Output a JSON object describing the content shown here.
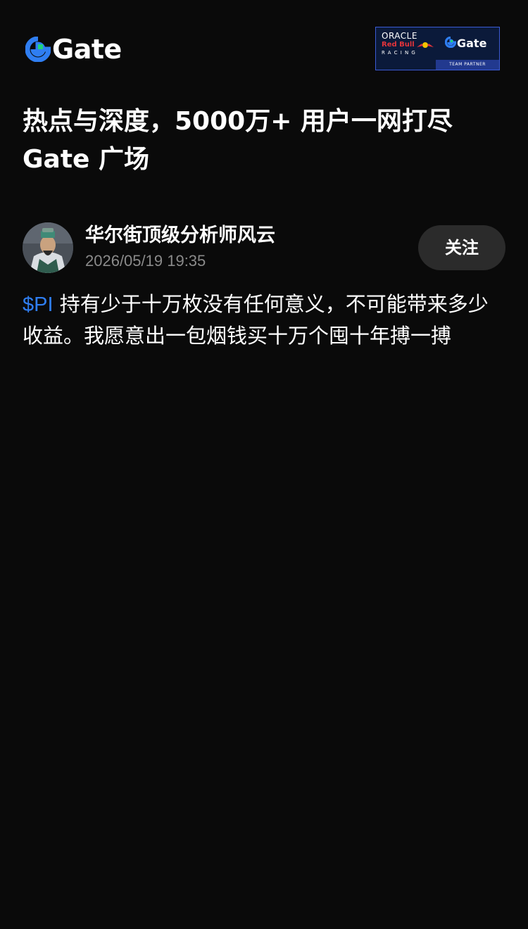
{
  "header": {
    "logo_text": "Gate",
    "brand_color": "#2f7ef2",
    "partner_badge": {
      "oracle": "ORACLE",
      "redbull": "Red Bull",
      "racing": "RACING",
      "gate_text": "Gate",
      "tag": "TEAM PARTNER"
    }
  },
  "headline": {
    "line1": "热点与深度，5000万+ 用户一网打尽",
    "line2": "Gate 广场"
  },
  "post": {
    "author_name": "华尔街顶级分析师风云",
    "timestamp": "2026/05/19 19:35",
    "follow_label": "关注",
    "ticker": "$PI",
    "text_line1_rest": " 持有少于十万枚没有任何意义，不可能带来多少",
    "text_line2": "收益。我愿意出一包烟钱买十万个囤十年搏一搏",
    "ticker_color": "#2f7ef2"
  }
}
